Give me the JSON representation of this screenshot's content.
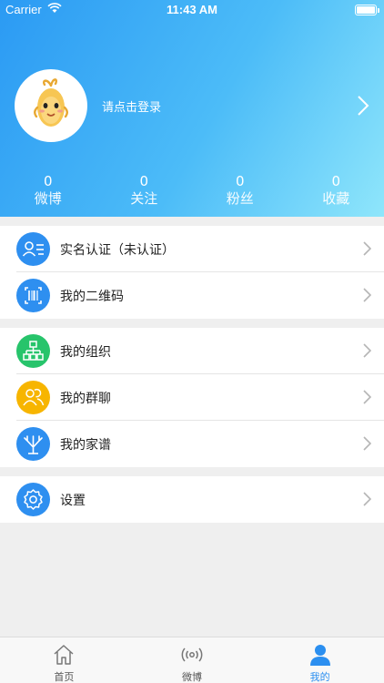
{
  "status_bar": {
    "carrier": "Carrier",
    "time": "11:43 AM"
  },
  "profile": {
    "login_prompt": "请点击登录"
  },
  "stats": [
    {
      "value": "0",
      "label": "微博"
    },
    {
      "value": "0",
      "label": "关注"
    },
    {
      "value": "0",
      "label": "粉丝"
    },
    {
      "value": "0",
      "label": "收藏"
    }
  ],
  "menu": {
    "section1": [
      {
        "label": "实名认证（未认证）",
        "icon": "id-card-icon",
        "color": "#2e8ff0"
      },
      {
        "label": "我的二维码",
        "icon": "qrcode-icon",
        "color": "#2e8ff0"
      }
    ],
    "section2": [
      {
        "label": "我的组织",
        "icon": "org-chart-icon",
        "color": "#27c46b"
      },
      {
        "label": "我的群聊",
        "icon": "group-icon",
        "color": "#f7b500"
      },
      {
        "label": "我的家谱",
        "icon": "family-tree-icon",
        "color": "#2e8ff0"
      }
    ],
    "section3": [
      {
        "label": "设置",
        "icon": "gear-icon",
        "color": "#2e8ff0"
      }
    ]
  },
  "tabbar": [
    {
      "label": "首页",
      "icon": "home-icon"
    },
    {
      "label": "微博",
      "icon": "broadcast-icon"
    },
    {
      "label": "我的",
      "icon": "person-icon",
      "active": true
    }
  ],
  "colors": {
    "accent": "#2b8ff0",
    "header_start": "#2b9af3",
    "header_end": "#8fe6fb"
  }
}
